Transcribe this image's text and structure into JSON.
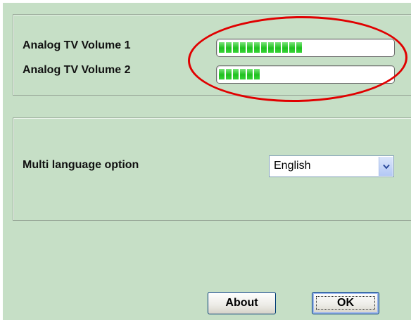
{
  "volumes": {
    "vol1": {
      "label": "Analog TV Volume 1",
      "level_segments": 12
    },
    "vol2": {
      "label": "Analog TV Volume 2",
      "level_segments": 6
    }
  },
  "language": {
    "label": "Multi language option",
    "selected": "English"
  },
  "buttons": {
    "about": "About",
    "ok": "OK"
  },
  "colors": {
    "background": "#c6dfc6",
    "level_fill": "#1fc11f",
    "highlight": "#e00000"
  }
}
